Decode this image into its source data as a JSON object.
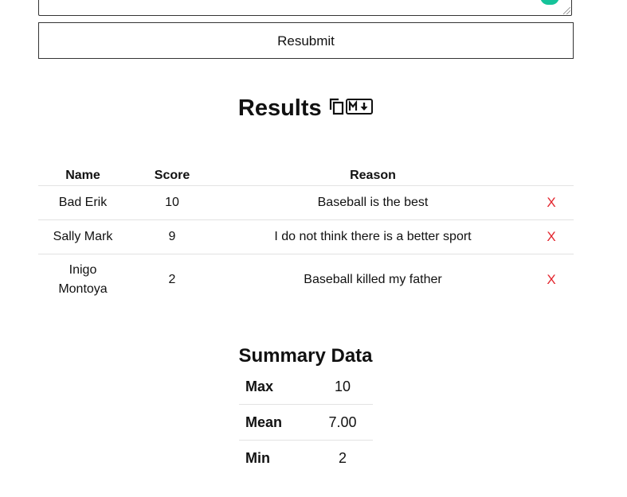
{
  "form": {
    "resubmit_label": "Resubmit"
  },
  "results": {
    "title": "Results",
    "copy_icon": "copy-icon",
    "markdown_icon": "markdown-download-icon",
    "columns": [
      "Name",
      "Score",
      "Reason",
      ""
    ],
    "rows": [
      {
        "name": "Bad Erik",
        "score": "10",
        "reason": "Baseball is the best",
        "delete": "X"
      },
      {
        "name": "Sally Mark",
        "score": "9",
        "reason": "I do not think there is a better sport",
        "delete": "X"
      },
      {
        "name": "Inigo Montoya",
        "score": "2",
        "reason": "Baseball killed my father",
        "delete": "X"
      }
    ]
  },
  "summary": {
    "title": "Summary Data",
    "rows": [
      {
        "label": "Max",
        "value": "10"
      },
      {
        "label": "Mean",
        "value": "7.00"
      },
      {
        "label": "Min",
        "value": "2"
      }
    ]
  },
  "colors": {
    "delete": "#e3262e",
    "grammarly": "#15c39a",
    "border": "#333333",
    "row_divider": "#e2e2e2"
  }
}
